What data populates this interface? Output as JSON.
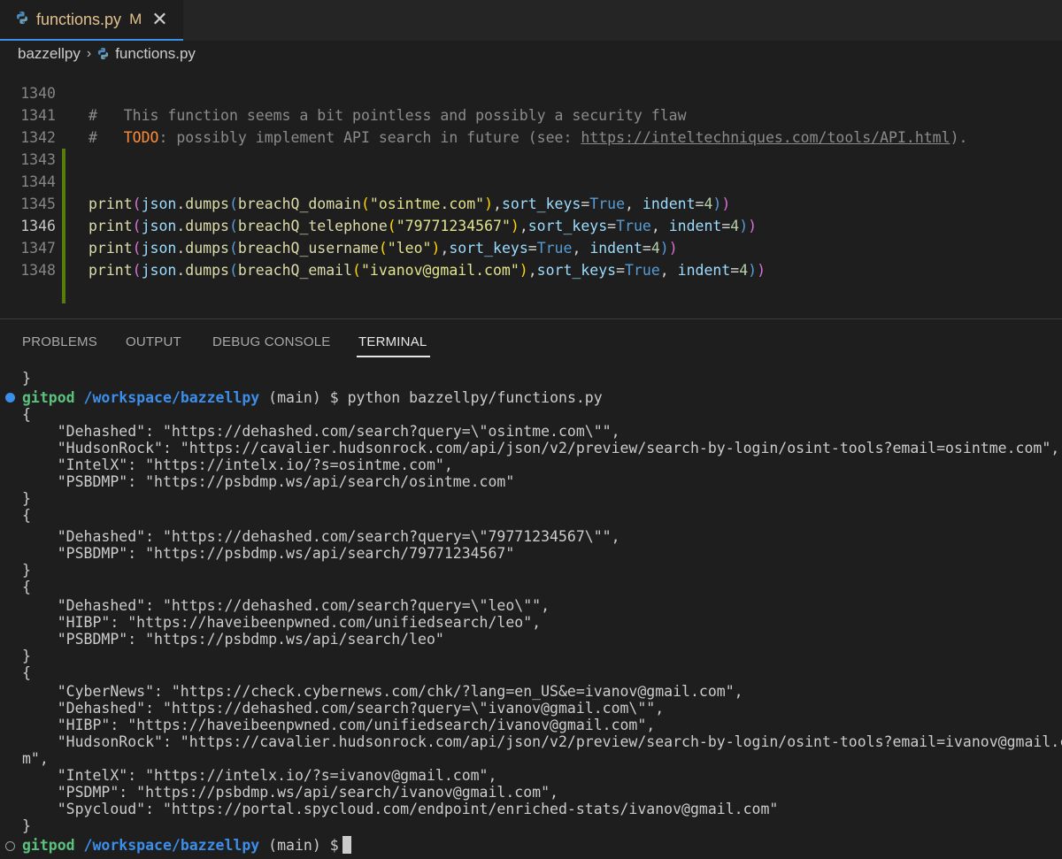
{
  "tab": {
    "filename": "functions.py",
    "modified_badge": "M",
    "close_glyph": "✕"
  },
  "breadcrumb": {
    "root": "bazzellpy",
    "separator": "›",
    "file": "functions.py"
  },
  "editor": {
    "lines": [
      {
        "num": "1340",
        "comment_prefix": "#   ",
        "text": "This function seems a bit pointless and possibly a security flaw"
      },
      {
        "num": "1341",
        "comment_prefix": "#   ",
        "todo": "TODO",
        "text": ": possibly implement API search in future (see: ",
        "url": "https://inteltechniques.com/tools/API.html",
        "text_after": ")."
      },
      {
        "num": "1342"
      },
      {
        "num": "1343",
        "fn": "breachQ_domain",
        "arg": "\"osintme.com\""
      },
      {
        "num": "1344",
        "fn": "breachQ_telephone",
        "arg": "\"79771234567\""
      },
      {
        "num": "1345",
        "fn": "breachQ_username",
        "arg": "\"leo\""
      },
      {
        "num": "1346",
        "fn": "breachQ_email",
        "arg": "\"ivanov@gmail.com\""
      },
      {
        "num": "1347"
      },
      {
        "num": "1348"
      }
    ],
    "code_tokens": {
      "print": "print",
      "json": "json",
      "dumps": "dumps",
      "sort_keys": "sort_keys",
      "true": "True",
      "indent": "indent",
      "indent_val": "4"
    }
  },
  "panel": {
    "tabs": [
      "PROBLEMS",
      "OUTPUT",
      "DEBUG CONSOLE",
      "TERMINAL"
    ],
    "active_tab": "TERMINAL"
  },
  "terminal": {
    "prompt_user": "gitpod",
    "prompt_path": "/workspace/bazzellpy",
    "prompt_branch": "(main)",
    "prompt_symbol": "$",
    "command": "python bazzellpy/functions.py",
    "lines": [
      "}",
      "{",
      "    \"Dehashed\": \"https://dehashed.com/search?query=\\\"osintme.com\\\"\",",
      "    \"HudsonRock\": \"https://cavalier.hudsonrock.com/api/json/v2/preview/search-by-login/osint-tools?email=osintme.com\",",
      "    \"IntelX\": \"https://intelx.io/?s=osintme.com\",",
      "    \"PSBDMP\": \"https://psbdmp.ws/api/search/osintme.com\"",
      "}",
      "{",
      "    \"Dehashed\": \"https://dehashed.com/search?query=\\\"79771234567\\\"\",",
      "    \"PSBDMP\": \"https://psbdmp.ws/api/search/79771234567\"",
      "}",
      "{",
      "    \"Dehashed\": \"https://dehashed.com/search?query=\\\"leo\\\"\",",
      "    \"HIBP\": \"https://haveibeenpwned.com/unifiedsearch/leo\",",
      "    \"PSBDMP\": \"https://psbdmp.ws/api/search/leo\"",
      "}",
      "{",
      "    \"CyberNews\": \"https://check.cybernews.com/chk/?lang=en_US&e=ivanov@gmail.com\",",
      "    \"Dehashed\": \"https://dehashed.com/search?query=\\\"ivanov@gmail.com\\\"\",",
      "    \"HIBP\": \"https://haveibeenpwned.com/unifiedsearch/ivanov@gmail.com\",",
      "    \"HudsonRock\": \"https://cavalier.hudsonrock.com/api/json/v2/preview/search-by-login/osint-tools?email=ivanov@gmail.co",
      "m\",",
      "    \"IntelX\": \"https://intelx.io/?s=ivanov@gmail.com\",",
      "    \"PSDMP\": \"https://psbdmp.ws/api/search/ivanov@gmail.com\",",
      "    \"Spycloud\": \"https://portal.spycloud.com/endpoint/enriched-stats/ivanov@gmail.com\"",
      "}"
    ]
  },
  "colors": {
    "accent": "#3b8eea",
    "prompt_green": "#5bc27d",
    "gutter_modified": "#587c0c",
    "tab_modified": "#e2c08d"
  },
  "icons": {
    "file_icon": "python-file-icon",
    "chevron": "chevron-right-icon"
  }
}
